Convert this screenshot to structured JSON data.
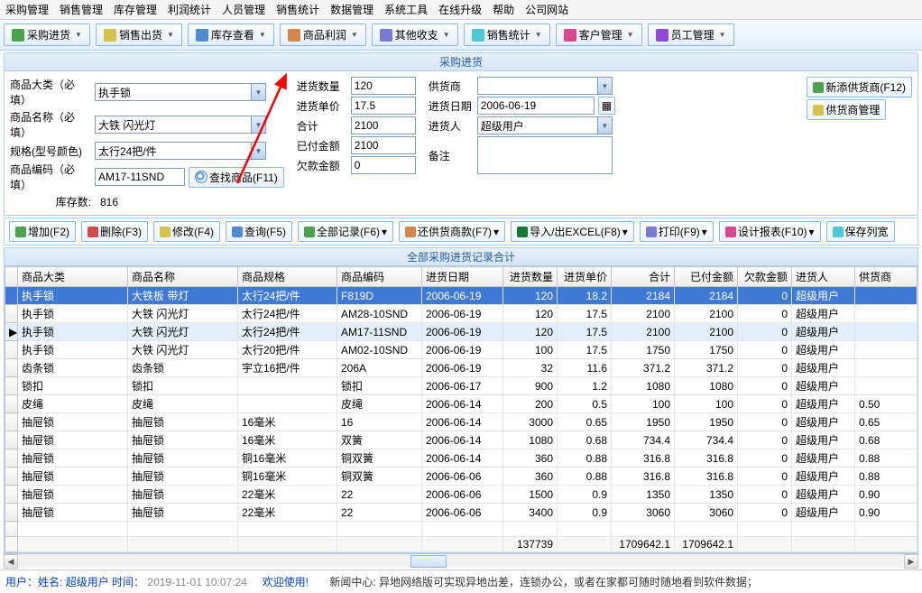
{
  "menu": [
    "采购管理",
    "销售管理",
    "库存管理",
    "利润统计",
    "人员管理",
    "销售统计",
    "数据管理",
    "系统工具",
    "在线升级",
    "帮助",
    "公司网站"
  ],
  "toolbar1": [
    {
      "icon": "#4aa54a",
      "label": "采购进货"
    },
    {
      "icon": "#d6c14a",
      "label": "销售出货"
    },
    {
      "icon": "#4a8cd6",
      "label": "库存查看"
    },
    {
      "icon": "#d6864a",
      "label": "商品利润"
    },
    {
      "icon": "#7a7ad6",
      "label": "其他收支"
    },
    {
      "icon": "#4acad6",
      "label": "销售统计"
    },
    {
      "icon": "#d64a8c",
      "label": "客户管理"
    },
    {
      "icon": "#8c4ad6",
      "label": "员工管理"
    }
  ],
  "panel_title": "采购进货",
  "form": {
    "labels": {
      "cat": "商品大类（必填）",
      "name": "商品名称（必填）",
      "spec": "规格(型号颜色)",
      "code": "商品编码（必填）",
      "stock_lbl": "库存数:",
      "qty": "进货数量",
      "price": "进货单价",
      "total": "合计",
      "paid": "已付金额",
      "owe": "欠款金额",
      "supplier": "供货商",
      "date": "进货日期",
      "person": "进货人",
      "remark": "备注"
    },
    "values": {
      "cat": "执手锁",
      "name": "大铁 闪光灯",
      "spec": "太行24把/件",
      "code": "AM17-11SND",
      "stock": "816",
      "qty": "120",
      "price": "17.5",
      "total": "2100",
      "paid": "2100",
      "owe": "0",
      "supplier": "",
      "date": "2006-06-19",
      "person": "超级用户",
      "remark": ""
    },
    "btns": {
      "find": "查找商品(F11)",
      "addsup": "新添供货商(F12)",
      "supmgr": "供货商管理"
    }
  },
  "actions": [
    {
      "ic": "#4aa54a",
      "t": "增加(F2)"
    },
    {
      "ic": "#d64a4a",
      "t": "删除(F3)"
    },
    {
      "ic": "#d6c14a",
      "t": "修改(F4)"
    },
    {
      "ic": "#4a8cd6",
      "t": "查询(F5)"
    },
    {
      "ic": "#4aa54a",
      "t": "全部记录(F6)"
    },
    {
      "ic": "#d6864a",
      "t": "还供货商款(F7)"
    },
    {
      "ic": "#167a36",
      "t": "导入/出EXCEL(F8)"
    },
    {
      "ic": "#7a7ad6",
      "t": "打印(F9)"
    },
    {
      "ic": "#d64a8c",
      "t": "设计报表(F10)"
    },
    {
      "ic": "#4acad6",
      "t": "保存列宽"
    }
  ],
  "table_title": "全部采购进货记录合计",
  "headers": [
    "商品大类",
    "商品名称",
    "商品规格",
    "商品编码",
    "进货日期",
    "进货数量",
    "进货单价",
    "合计",
    "已付金额",
    "欠款金额",
    "进货人",
    "供货商"
  ],
  "rows": [
    {
      "sel": true,
      "c": [
        "执手锁",
        "大铁板 带灯",
        "太行24把/件",
        "F819D",
        "2006-06-19",
        "120",
        "18.2",
        "2184",
        "2184",
        "0",
        "超级用户",
        ""
      ]
    },
    {
      "c": [
        "执手锁",
        "大铁 闪光灯",
        "太行24把/件",
        "AM28-10SND",
        "2006-06-19",
        "120",
        "17.5",
        "2100",
        "2100",
        "0",
        "超级用户",
        ""
      ]
    },
    {
      "hi": true,
      "mark": "▶",
      "c": [
        "执手锁",
        "大铁 闪光灯",
        "太行24把/件",
        "AM17-11SND",
        "2006-06-19",
        "120",
        "17.5",
        "2100",
        "2100",
        "0",
        "超级用户",
        ""
      ]
    },
    {
      "c": [
        "执手锁",
        "大铁 闪光灯",
        "太行20把/件",
        "AM02-10SND",
        "2006-06-19",
        "100",
        "17.5",
        "1750",
        "1750",
        "0",
        "超级用户",
        ""
      ]
    },
    {
      "c": [
        "齿条锁",
        "齿条锁",
        "宇立16把/件",
        "206A",
        "2006-06-19",
        "32",
        "11.6",
        "371.2",
        "371.2",
        "0",
        "超级用户",
        ""
      ]
    },
    {
      "c": [
        "锁扣",
        "锁扣",
        "",
        "锁扣",
        "2006-06-17",
        "900",
        "1.2",
        "1080",
        "1080",
        "0",
        "超级用户",
        ""
      ]
    },
    {
      "c": [
        "皮绳",
        "皮绳",
        "",
        "皮绳",
        "2006-06-14",
        "200",
        "0.5",
        "100",
        "100",
        "0",
        "超级用户",
        "0.50"
      ]
    },
    {
      "c": [
        "抽屉锁",
        "抽屉锁",
        "16毫米",
        "16",
        "2006-06-14",
        "3000",
        "0.65",
        "1950",
        "1950",
        "0",
        "超级用户",
        "0.65"
      ]
    },
    {
      "c": [
        "抽屉锁",
        "抽屉锁",
        "16毫米",
        "双簧",
        "2006-06-14",
        "1080",
        "0.68",
        "734.4",
        "734.4",
        "0",
        "超级用户",
        "0.68"
      ]
    },
    {
      "c": [
        "抽屉锁",
        "抽屉锁",
        "铜16毫米",
        "铜双簧",
        "2006-06-14",
        "360",
        "0.88",
        "316.8",
        "316.8",
        "0",
        "超级用户",
        "0.88"
      ]
    },
    {
      "c": [
        "抽屉锁",
        "抽屉锁",
        "铜16毫米",
        "铜双簧",
        "2006-06-06",
        "360",
        "0.88",
        "316.8",
        "316.8",
        "0",
        "超级用户",
        "0.88"
      ]
    },
    {
      "c": [
        "抽屉锁",
        "抽屉锁",
        "22毫米",
        "22",
        "2006-06-06",
        "1500",
        "0.9",
        "1350",
        "1350",
        "0",
        "超级用户",
        "0.90"
      ]
    },
    {
      "c": [
        "抽屉锁",
        "抽屉锁",
        "22毫米",
        "22",
        "2006-06-06",
        "3400",
        "0.9",
        "3060",
        "3060",
        "0",
        "超级用户",
        "0.90"
      ]
    }
  ],
  "totals": [
    "",
    "",
    "",
    "",
    "",
    "137739",
    "",
    "1709642.1",
    "1709642.1",
    "",
    "",
    ""
  ],
  "footer": {
    "user_lbl": "用户：姓名:",
    "user": "超级用户",
    "time_lbl": "时间：",
    "time": "2019-11-01 10:07:24",
    "welcome": "欢迎使用!",
    "news_lbl": "新闻中心:",
    "news": "异地网络版可实现异地出差，连锁办公，或者在家都可随时随地看到软件数据；"
  }
}
